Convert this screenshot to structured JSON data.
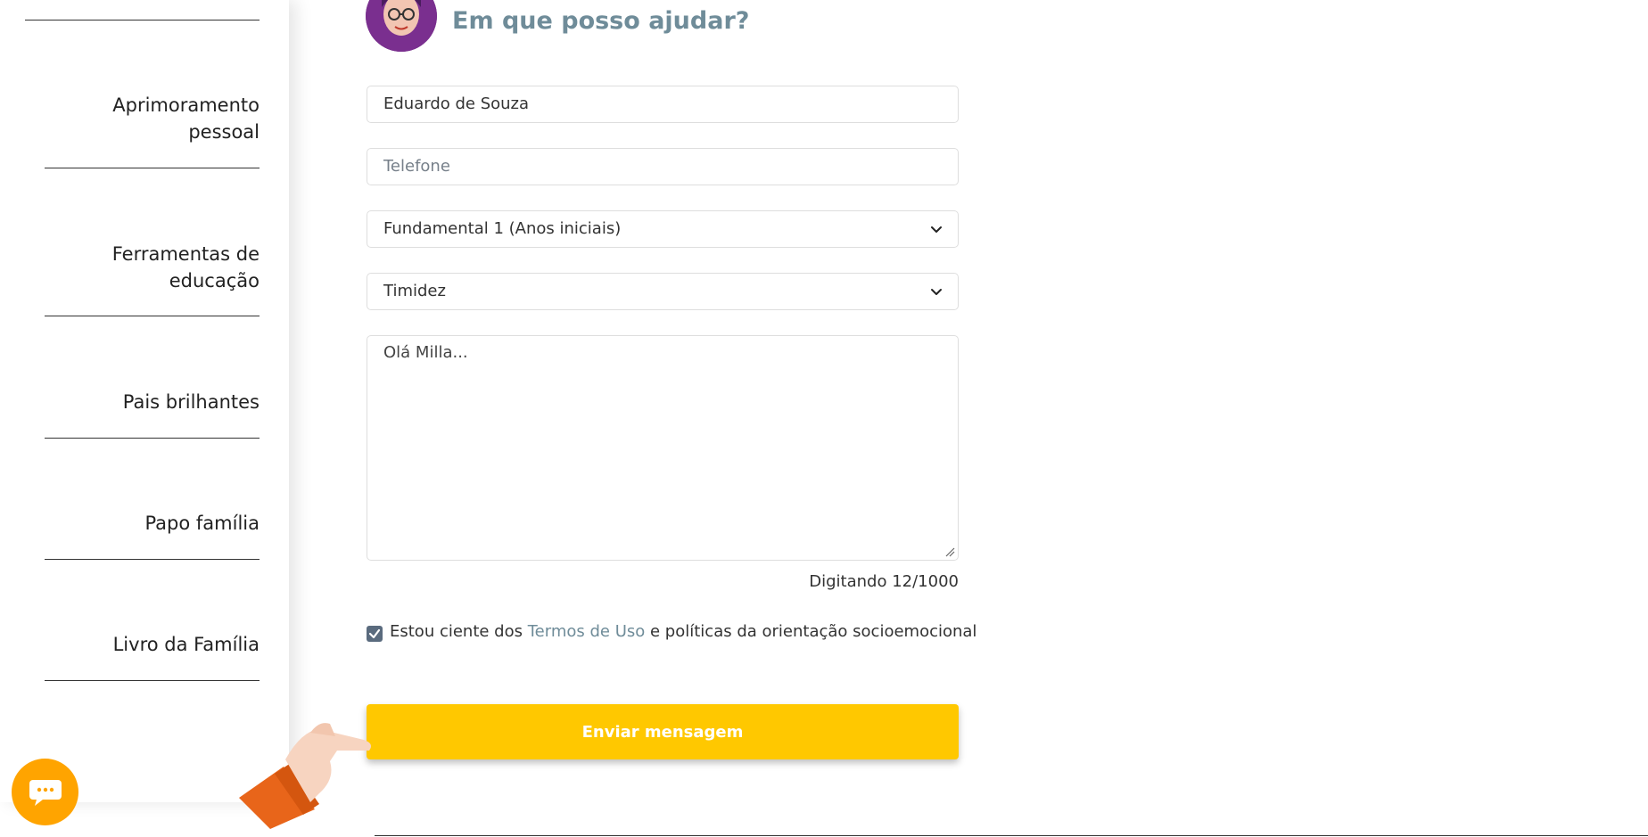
{
  "sidebar": {
    "items": [
      {
        "label": "Aprimoramento pessoal"
      },
      {
        "label": "Ferramentas de educação"
      },
      {
        "label": "Pais brilhantes"
      },
      {
        "label": "Papo família"
      },
      {
        "label": "Livro da Família"
      }
    ]
  },
  "header": {
    "title": "Em que posso ajudar?"
  },
  "form": {
    "name_value": "Eduardo de Souza",
    "phone_placeholder": "Telefone",
    "level_select": "Fundamental 1 (Anos iniciais)",
    "topic_select": "Timidez",
    "message_value": "Olá Milla...",
    "counter": "Digitando 12/1000",
    "terms_prefix": "Estou ciente dos",
    "terms_link": "Termos de Uso",
    "terms_suffix": "e políticas da orientação socioemocional",
    "terms_checked": true,
    "submit_label": "Enviar mensagem"
  },
  "colors": {
    "accent": "#ffc800",
    "title": "#6f8c99",
    "chat": "#ffa400"
  },
  "icons": [
    "chevron-down-icon",
    "checkmark-icon",
    "chat-icon",
    "pointing-hand-icon",
    "avatar"
  ]
}
